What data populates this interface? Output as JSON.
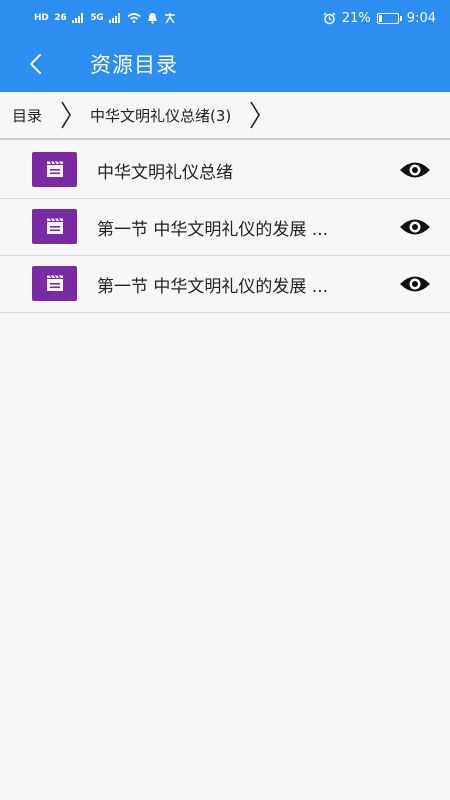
{
  "status_bar": {
    "left_indicators": [
      "HD",
      "26",
      "5G"
    ],
    "battery_percent": "21%",
    "battery_level": 0.21,
    "time": "9:04"
  },
  "header": {
    "title": "资源目录"
  },
  "breadcrumb": {
    "root": "目录",
    "current": "中华文明礼仪总绪(3)"
  },
  "items": [
    {
      "title": "中华文明礼仪总绪",
      "icon": "clapperboard-icon",
      "action_icon": "eye-icon"
    },
    {
      "title": "第一节 中华文明礼仪的发展 ...",
      "icon": "clapperboard-icon",
      "action_icon": "eye-icon"
    },
    {
      "title": "第一节 中华文明礼仪的发展 ...",
      "icon": "clapperboard-icon",
      "action_icon": "eye-icon"
    }
  ],
  "colors": {
    "primary": "#2c8ef0",
    "file_icon": "#7b2aa6",
    "background": "#f7f7f7"
  }
}
